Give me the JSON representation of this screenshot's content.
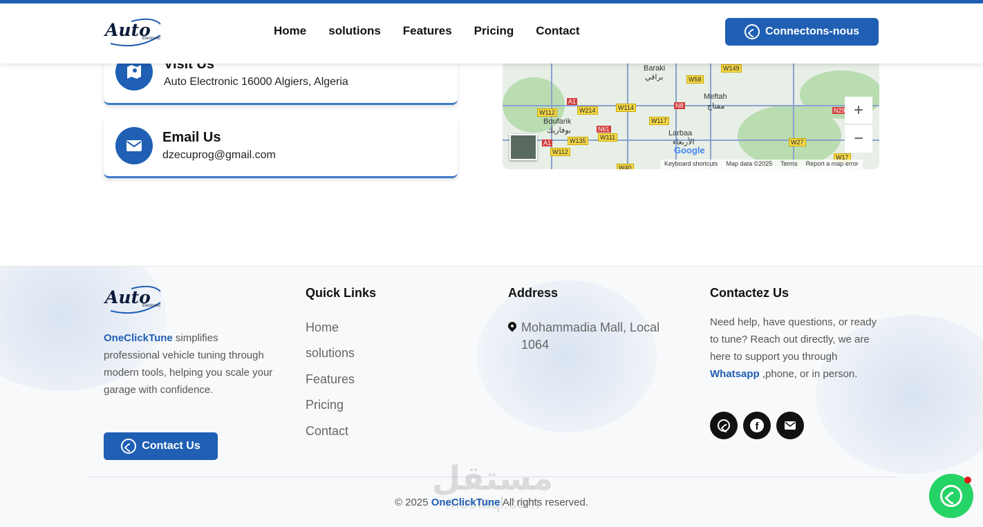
{
  "header": {
    "logo_word": "Auto",
    "logo_sub": "Electronic",
    "nav": [
      "Home",
      "solutions",
      "Features",
      "Pricing",
      "Contact"
    ],
    "cta_label": "Connectons-nous"
  },
  "contact_cards": {
    "visit": {
      "title": "Visit Us",
      "text": "Auto Electronic 16000 Algiers, Algeria"
    },
    "email": {
      "title": "Email Us",
      "text": "dzecuprog@gmail.com"
    }
  },
  "map": {
    "places": [
      "Baraki",
      "براقي",
      "Meftah",
      "مفتاح",
      "Boufarik",
      "بوفاريك",
      "Larbaa",
      "الأربعاء"
    ],
    "roads": [
      "W149",
      "W58",
      "A1",
      "W214",
      "W114",
      "N8",
      "W112",
      "N61",
      "W117",
      "W111",
      "W135",
      "A1",
      "W112",
      "W27",
      "N29",
      "W17",
      "W40"
    ],
    "zoom_in": "+",
    "zoom_out": "−",
    "google_label": "Google",
    "footer_links": [
      "Keyboard shortcuts",
      "Map data ©2025",
      "Terms",
      "Report a map error"
    ]
  },
  "footer": {
    "about_brand": "OneClickTune",
    "about_text": " simplifies professional vehicle tuning through modern tools, helping you scale your garage with confidence.",
    "contact_button": "Contact Us",
    "quick_links_title": "Quick Links",
    "quick_links": [
      "Home",
      "solutions",
      "Features",
      "Pricing",
      "Contact"
    ],
    "address_title": "Address",
    "address_line1": "Mohammadia Mall, Local",
    "address_line2": "1064",
    "contact_title": "Contactez Us",
    "contact_text_a": "Need help, have questions, or ready to tune? Reach out directly, we are here to support you through ",
    "contact_text_link": "Whatsapp",
    "contact_text_b": " ,phone, or in person.",
    "social_icons": [
      "whatsapp-icon",
      "facebook-icon",
      "envelope-icon"
    ],
    "copyright_a": "© 2025 ",
    "copyright_brand": "OneClickTune",
    "copyright_b": " All rights reserved.",
    "watermark_ar": "مستقل",
    "watermark_en": "mostaql.com"
  },
  "colors": {
    "primary": "#1f5fb4",
    "whatsapp": "#25d366"
  }
}
